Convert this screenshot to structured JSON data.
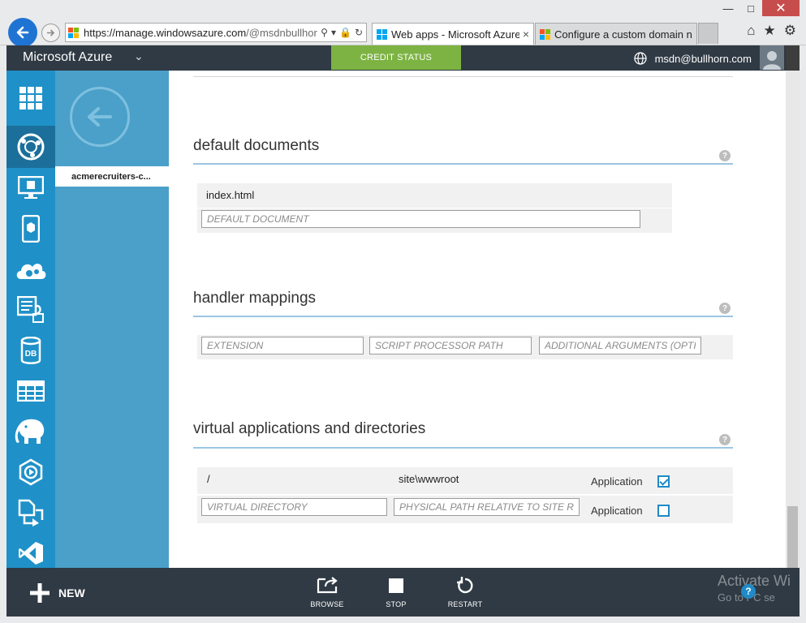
{
  "browser": {
    "url_host": "https://manage.windowsazure.com",
    "url_path": "/@msdnbullhorn",
    "tabs": [
      {
        "title": "Web apps - Microsoft Azure",
        "active": true
      },
      {
        "title": "Configure a custom domain n...",
        "active": false
      }
    ],
    "tools": [
      "home-icon",
      "favorites-star-icon",
      "settings-gear-icon"
    ]
  },
  "header": {
    "brand": "Microsoft Azure",
    "credit_status": "CREDIT STATUS",
    "account": "msdn@bullhorn.com"
  },
  "nav": {
    "icons": [
      "all-items-grid-icon",
      "web-apps-globe-icon",
      "virtual-machines-monitor-icon",
      "mobile-services-icon",
      "cloud-services-icon",
      "batch-services-icon",
      "sql-databases-icon",
      "storage-table-icon",
      "hdinsight-elephant-icon",
      "media-services-icon",
      "service-bus-icon",
      "visual-studio-icon"
    ],
    "active_index": 1
  },
  "subnav": {
    "item": "acmerecruiters-c..."
  },
  "sections": {
    "default_documents": {
      "title": "default documents",
      "entries": [
        "index.html"
      ],
      "placeholder": "DEFAULT DOCUMENT"
    },
    "handler_mappings": {
      "title": "handler mappings",
      "placeholders": {
        "extension": "EXTENSION",
        "script_processor": "SCRIPT PROCESSOR PATH",
        "arguments": "ADDITIONAL ARGUMENTS (OPTIONAL)"
      }
    },
    "virtual_apps": {
      "title": "virtual applications and directories",
      "rows": [
        {
          "virtual": "/",
          "physical": "site\\wwwroot",
          "label": "Application",
          "checked": true
        }
      ],
      "new_row": {
        "virtual_placeholder": "VIRTUAL DIRECTORY",
        "physical_placeholder": "PHYSICAL PATH RELATIVE TO SITE ROOT",
        "label": "Application",
        "checked": false
      }
    }
  },
  "command_bar": {
    "new_label": "NEW",
    "commands": [
      {
        "label": "BROWSE",
        "icon": "browse-icon"
      },
      {
        "label": "STOP",
        "icon": "stop-icon"
      },
      {
        "label": "RESTART",
        "icon": "restart-icon"
      }
    ]
  },
  "watermark": {
    "line1": "Activate Wi",
    "line2": "Go to PC se"
  },
  "colors": {
    "nav_blue": "#1f91c8",
    "nav_active": "#1b6f9a",
    "subnav_blue": "#4aa0c9",
    "bar_dark": "#2f3a44",
    "credit_green": "#7cb342",
    "accent": "#1f8ac7"
  }
}
